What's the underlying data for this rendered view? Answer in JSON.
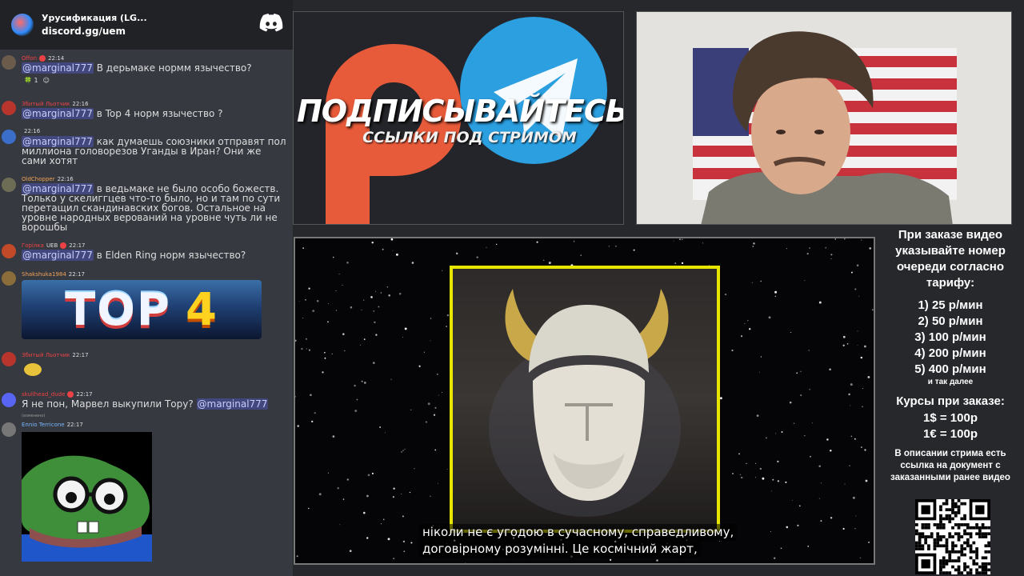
{
  "chat": {
    "server_title": "Урусификация (LG...",
    "invite_link": "discord.gg/uem",
    "messages": [
      {
        "author": "Offon",
        "time": "22:14",
        "mention": "@marginal777",
        "text": " В дерьмаке нормм язычество?",
        "reactions": [
          "1",
          ""
        ]
      },
      {
        "author": "Збитый Льотчик",
        "time": "22:16",
        "mention": "@marginal777",
        "text": " в Top 4 норм язычество  ?"
      },
      {
        "author": "",
        "time": "22:16",
        "mention": "@marginal777",
        "text": " как думаешь союзники отправят пол миллиона головорезов Уганды в Иран? Они же сами хотят"
      },
      {
        "author": "OldChopper",
        "time": "22:16",
        "mention": "@marginal777",
        "text": " в ведьмаке не было особо божеств. Только у скелиггцев что-то было, но и там по сути перетащил скандинавских богов. Остальное на уровне народных верований на уровне чуть ли не ворошбы"
      },
      {
        "author": "Горілка",
        "tag": "UEB",
        "time": "22:17",
        "mention": "@marginal777",
        "text": " в Elden Ring норм язычество?"
      },
      {
        "author": "Shakshuka1984",
        "time": "22:17",
        "image_text": [
          "TOP",
          "4"
        ]
      },
      {
        "author": "Збитый Льотчик",
        "time": "22:17"
      },
      {
        "author": "skullhead_dude",
        "time": "22:17",
        "text": "Я не пон, Марвел выкупили Тору? ",
        "mention": "@marginal777",
        "edited": "(изменено)"
      },
      {
        "author": "Ennio Terricone",
        "time": "22:17"
      }
    ]
  },
  "promo": {
    "title": "ПОДПИСЫВАЙТЕСЬ",
    "subtitle": "ССЫЛКИ ПОД СТРИМОМ"
  },
  "video": {
    "subtitle_line1": "ніколи не є угодою в сучасному, справедливому,",
    "subtitle_line2": "договірному розумінні.  Це космічний жарт,"
  },
  "info": {
    "heading": "При заказе видео указывайте номер очереди согласно тарифу:",
    "tariffs": [
      "1) 25 р/мин",
      "2) 50 р/мин",
      "3) 100 р/мин",
      "4) 200 р/мин",
      "5) 400 р/мин"
    ],
    "etc": "и так далее",
    "rates_title": "Курсы при заказе:",
    "rates": [
      "1$ = 100р",
      "1€ = 100р"
    ],
    "footer": "В описании стрима есть ссылка на документ с заказанными ранее видео"
  },
  "colors": {
    "discord_bg": "#36393f",
    "discord_header": "#202225",
    "mention_bg": "#5865f2",
    "frame_yellow": "#e6e600",
    "telegram_blue": "#2b9fe0",
    "patreon_orange": "#e85b3a"
  }
}
